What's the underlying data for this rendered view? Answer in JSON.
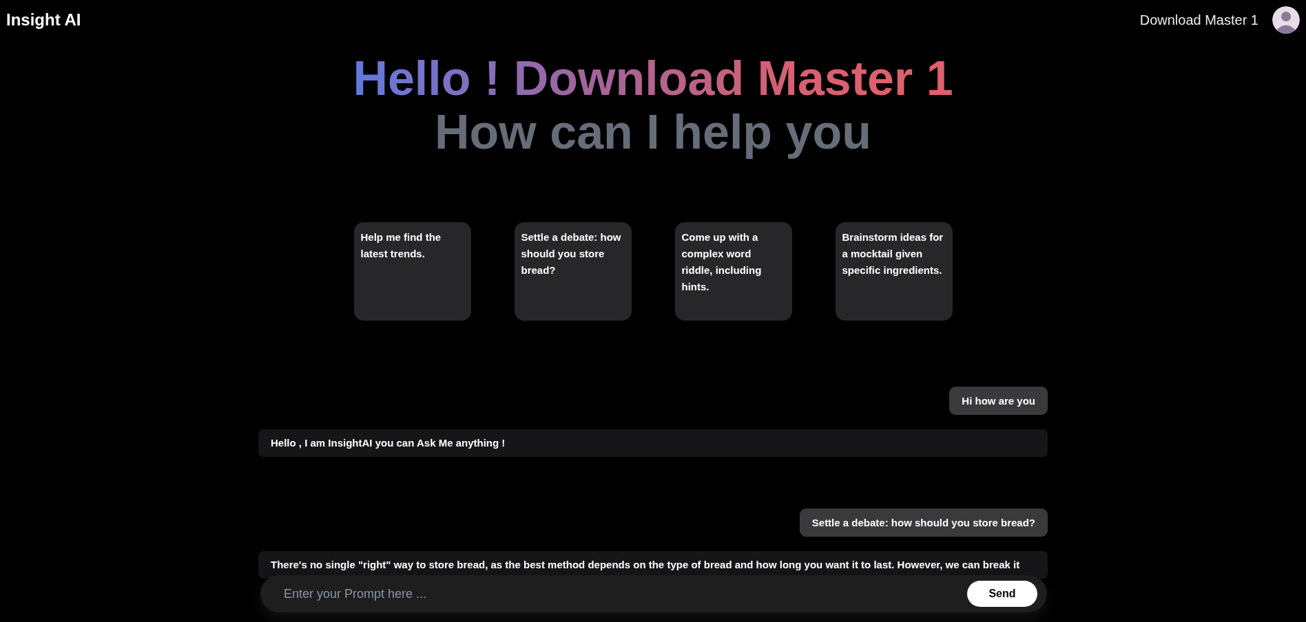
{
  "header": {
    "brand": "Insight AI",
    "user_name": "Download Master 1"
  },
  "hero": {
    "greeting": "Hello ! Download Master 1",
    "subtitle": "How can I help you"
  },
  "suggestions": [
    {
      "text": "Help me find the latest trends."
    },
    {
      "text": "Settle a debate: how should you store bread?"
    },
    {
      "text": "Come up with a complex word riddle, including hints."
    },
    {
      "text": "Brainstorm ideas for a mocktail given specific ingredients."
    }
  ],
  "messages": [
    {
      "kind": "user",
      "text": "Hi how are you"
    },
    {
      "kind": "bot",
      "text": "Hello , I am InsightAI you can Ask Me anything !"
    },
    {
      "kind": "user",
      "text": "Settle a debate: how should you store bread?"
    },
    {
      "kind": "bot",
      "text": "There's no single \"right\" way to store bread, as the best method depends on the type of bread and how long you want it to last. However, we can break it"
    }
  ],
  "prompt": {
    "placeholder": "Enter your Prompt here ...",
    "button": "Send"
  }
}
